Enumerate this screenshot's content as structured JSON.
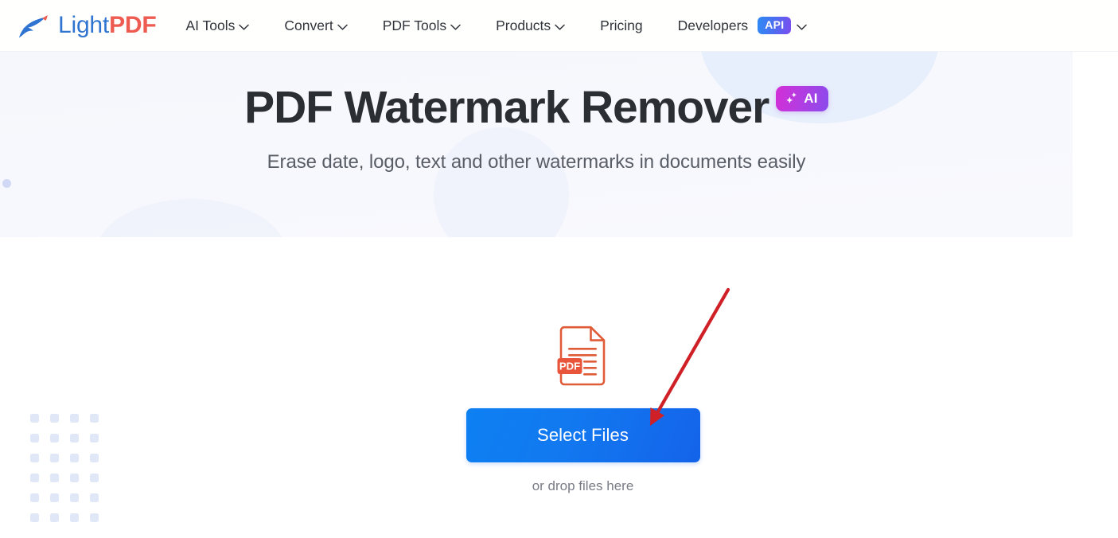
{
  "header": {
    "logo": {
      "name": "LightPDF",
      "text_light": "Light",
      "text_pdf": "PDF",
      "icon": "lightpdf-bird-logo",
      "color_light": "#2f74d0",
      "color_pdf": "#ee5b51"
    },
    "nav": [
      {
        "label": "AI Tools",
        "has_dropdown": true,
        "icon": "chevron-down-icon"
      },
      {
        "label": "Convert",
        "has_dropdown": true,
        "icon": "chevron-down-icon"
      },
      {
        "label": "PDF Tools",
        "has_dropdown": true,
        "icon": "chevron-down-icon"
      },
      {
        "label": "Products",
        "has_dropdown": true,
        "icon": "chevron-down-icon"
      },
      {
        "label": "Pricing",
        "has_dropdown": false,
        "icon": ""
      },
      {
        "label": "Developers",
        "has_dropdown": true,
        "icon": "chevron-down-icon",
        "badge": "API"
      }
    ]
  },
  "hero": {
    "title": "PDF Watermark Remover",
    "badge": {
      "label": "AI",
      "icon": "sparkle-icon",
      "gradient_from": "#d32fd6",
      "gradient_to": "#8a4bec"
    },
    "subtitle": "Erase date, logo, text and other watermarks in documents easily"
  },
  "upload": {
    "file_icon": "pdf-file-icon",
    "file_icon_label": "PDF",
    "file_icon_color": "#e05c38",
    "button_label": "Select Files",
    "button_color": "#0d80f2",
    "drop_hint": "or drop files here"
  },
  "annotation": {
    "arrow": "red-arrow-pointing-to-select-files-button",
    "color": "#cf2027"
  },
  "decor": {
    "dot_grid": "blue-dot-grid-pattern",
    "dot_grid_color": "#dde6f7"
  }
}
